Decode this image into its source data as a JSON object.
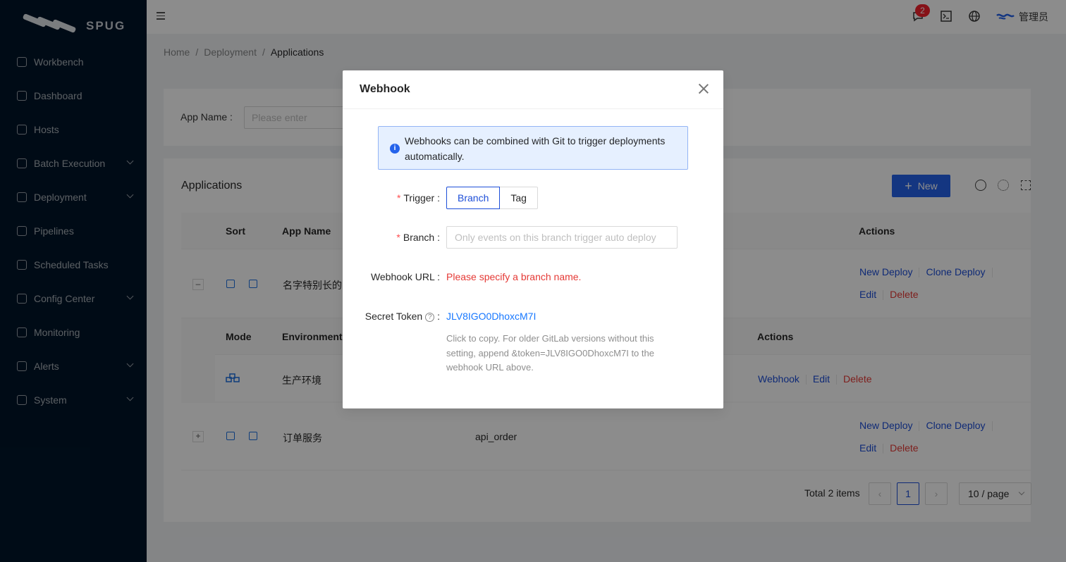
{
  "brand": {
    "name": "SPUG"
  },
  "sidebar": {
    "items": [
      {
        "label": "Workbench",
        "icon": "monitor-icon",
        "has_submenu": false
      },
      {
        "label": "Dashboard",
        "icon": "dashboard-icon",
        "has_submenu": false
      },
      {
        "label": "Hosts",
        "icon": "cloud-icon",
        "has_submenu": false
      },
      {
        "label": "Batch Execution",
        "icon": "terminal-icon",
        "has_submenu": true
      },
      {
        "label": "Deployment",
        "icon": "flag-icon",
        "has_submenu": true
      },
      {
        "label": "Pipelines",
        "icon": "flag-icon",
        "has_submenu": false
      },
      {
        "label": "Scheduled Tasks",
        "icon": "calendar-icon",
        "has_submenu": false
      },
      {
        "label": "Config Center",
        "icon": "deployment-unit-icon",
        "has_submenu": true
      },
      {
        "label": "Monitoring",
        "icon": "search-icon",
        "has_submenu": false
      },
      {
        "label": "Alerts",
        "icon": "alert-icon",
        "has_submenu": true
      },
      {
        "label": "System",
        "icon": "gear-icon",
        "has_submenu": true
      }
    ]
  },
  "header": {
    "notification_count": "2",
    "user_name": "管理员"
  },
  "breadcrumb": {
    "items": [
      "Home",
      "Deployment",
      "Applications"
    ]
  },
  "filter": {
    "label": "App Name",
    "colon": ":",
    "placeholder": "Please enter"
  },
  "table": {
    "title": "Applications",
    "new_button": "New",
    "columns": {
      "sort": "Sort",
      "app_name": "App Name",
      "actions": "Actions"
    },
    "rows": [
      {
        "expand": "–",
        "name": "名字特别长的",
        "key": "",
        "actions": [
          "New Deploy",
          "Clone Deploy",
          "Edit",
          "Delete"
        ]
      },
      {
        "expand": "+",
        "name": "订单服务",
        "key": "api_order",
        "actions": [
          "New Deploy",
          "Clone Deploy",
          "Edit",
          "Delete"
        ]
      }
    ],
    "sub": {
      "columns": {
        "mode": "Mode",
        "environment": "Environment",
        "actions": "Actions"
      },
      "row": {
        "environment": "生产环境",
        "actions": [
          "Webhook",
          "Edit",
          "Delete"
        ]
      }
    },
    "pagination": {
      "total": "Total 2 items",
      "current": "1",
      "page_size": "10 / page"
    }
  },
  "modal": {
    "title": "Webhook",
    "alert": "Webhooks can be combined with Git to trigger deployments automatically.",
    "trigger_label": "Trigger",
    "trigger_options": [
      "Branch",
      "Tag"
    ],
    "trigger_selected": "Branch",
    "branch_label": "Branch",
    "branch_placeholder": "Only events on this branch trigger auto deploy",
    "url_label": "Webhook URL",
    "url_value": "Please specify a branch name.",
    "token_label": "Secret Token",
    "token_value": "JLV8IGO0DhoxcM7I",
    "token_help": "Click to copy. For older GitLab versions without this setting, append &token=JLV8IGO0DhoxcM7I to the webhook URL above.",
    "colon": ":"
  },
  "colors": {
    "sidebar_bg": "#001529",
    "primary": "#2563eb",
    "link": "#1d4ed8",
    "danger": "#e53935",
    "badge": "#f5222d"
  }
}
